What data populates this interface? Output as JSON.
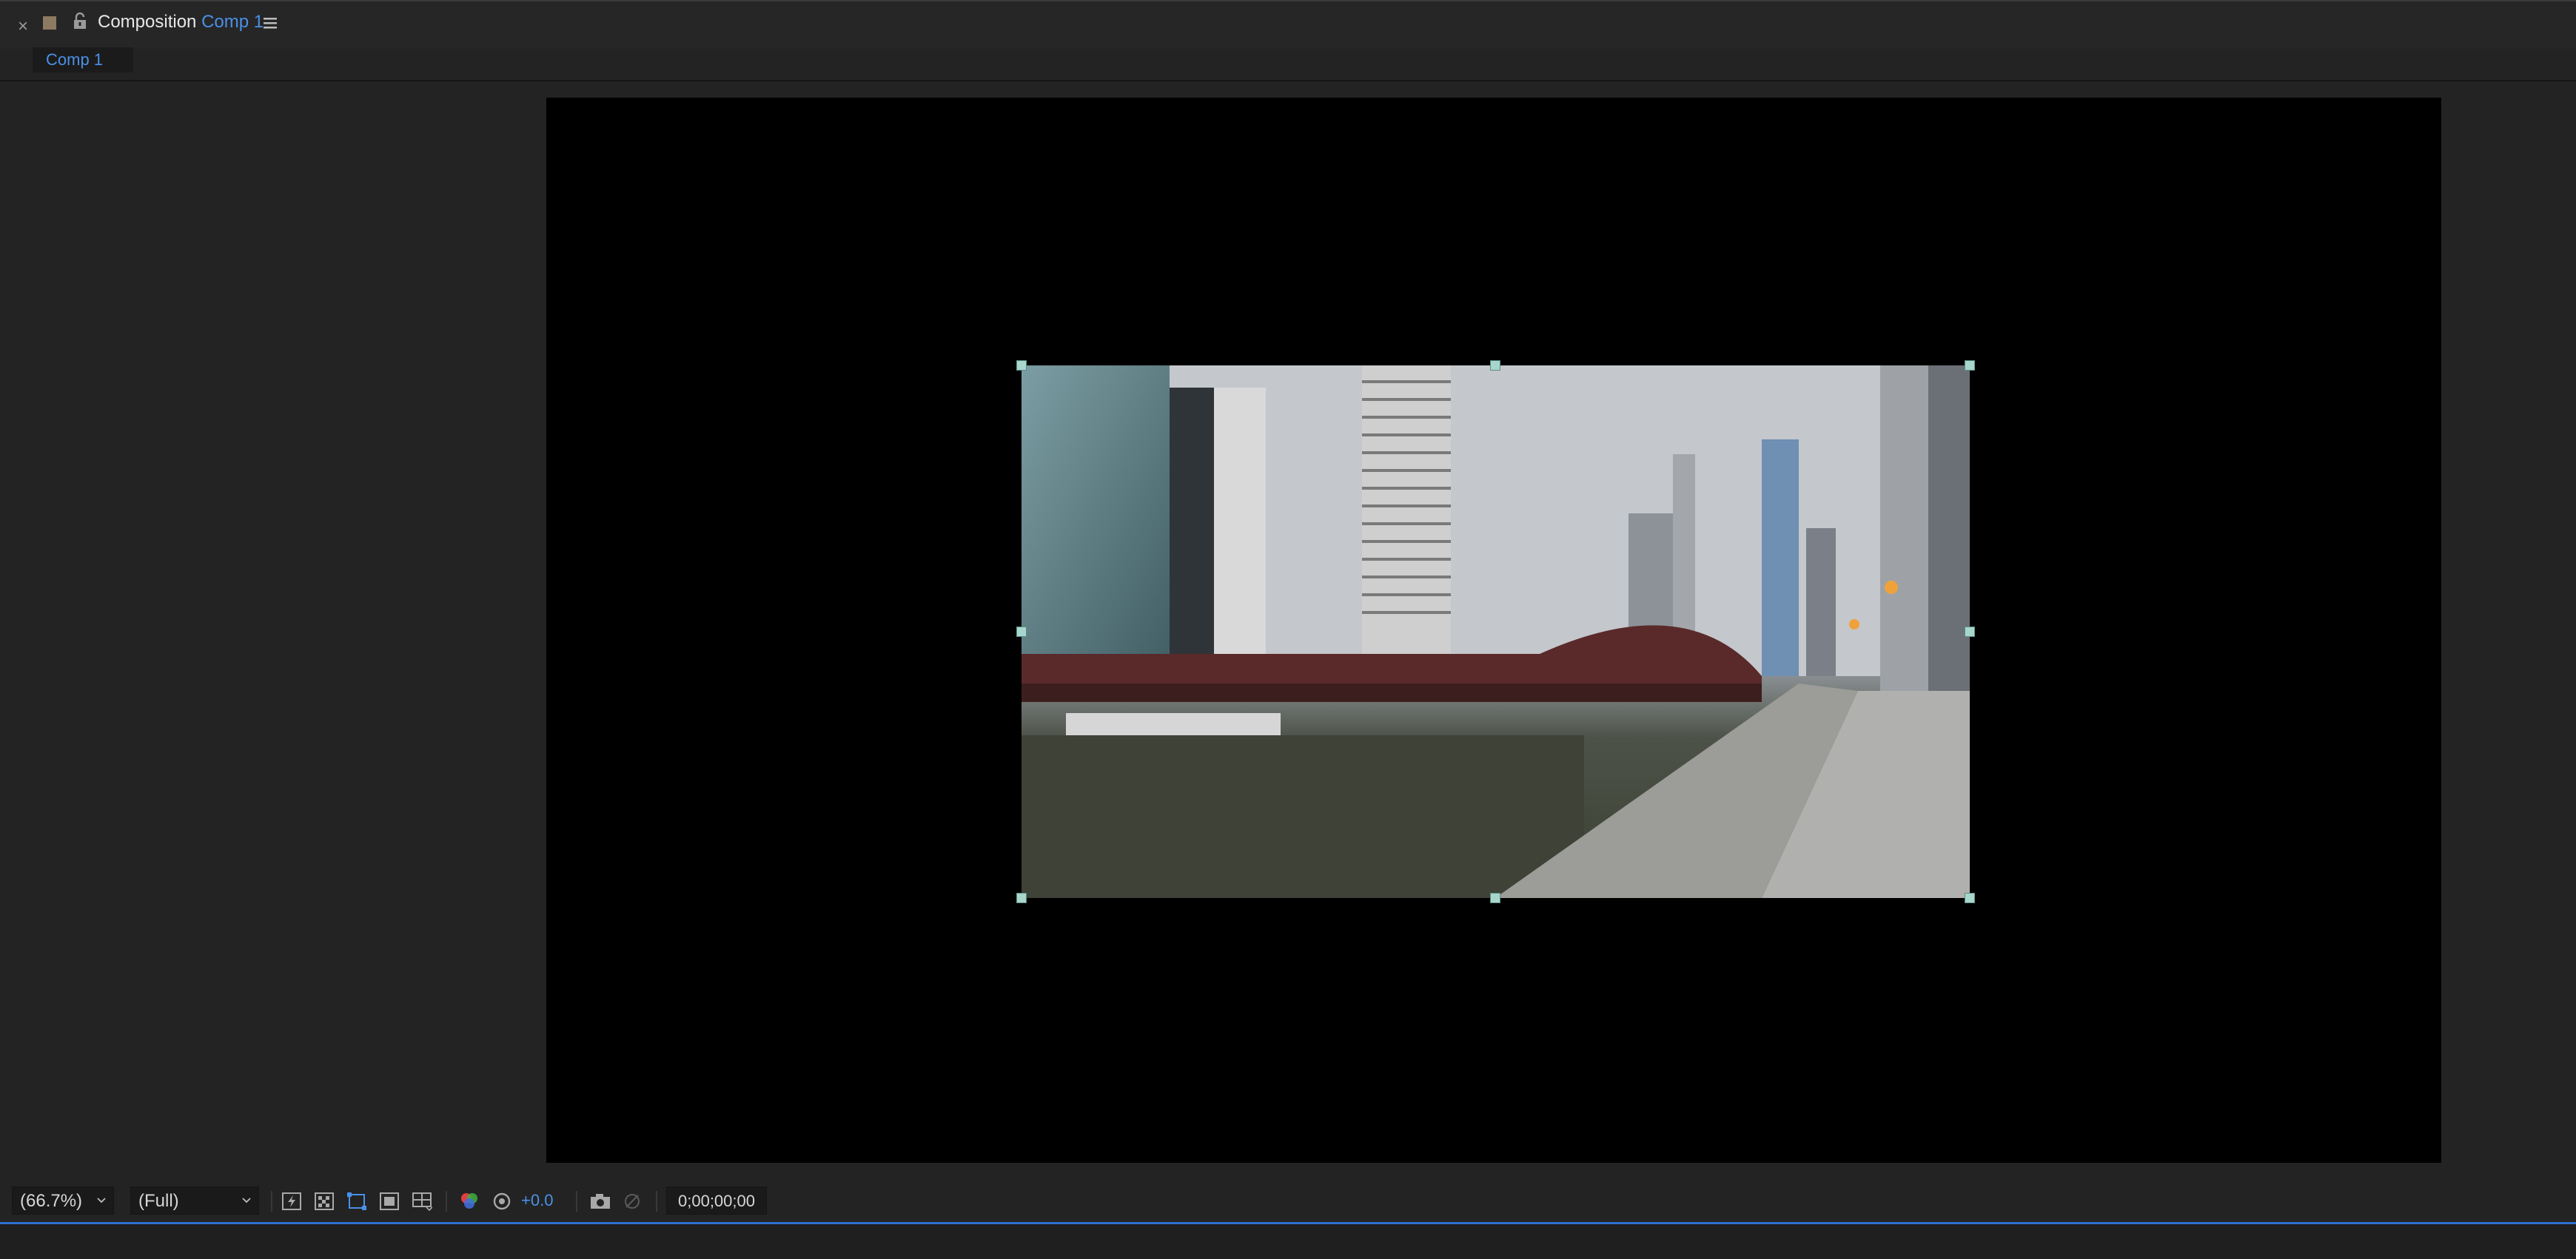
{
  "tab": {
    "close_glyph": "×",
    "title_prefix": "Composition",
    "title_comp": "Comp 1"
  },
  "subtab": {
    "label": "Comp 1"
  },
  "toolbar": {
    "zoom": "(66.7%)",
    "resolution": "(Full)",
    "exposure": "+0.0",
    "timecode": "0;00;00;00"
  },
  "colors": {
    "accent": "#4a90e8",
    "handle": "#a7d6cc",
    "timeline_line": "#2f6fd1"
  },
  "icons": {
    "tab": [
      "close-icon",
      "label-swatch-icon",
      "lock-icon",
      "panel-menu-icon"
    ],
    "toolbar": [
      "fast-preview-icon",
      "transparency-grid-icon",
      "region-of-interest-icon",
      "mask-visibility-icon",
      "guides-icon",
      "color-channels-icon",
      "exposure-reset-icon",
      "snapshot-icon",
      "show-snapshot-icon"
    ]
  }
}
